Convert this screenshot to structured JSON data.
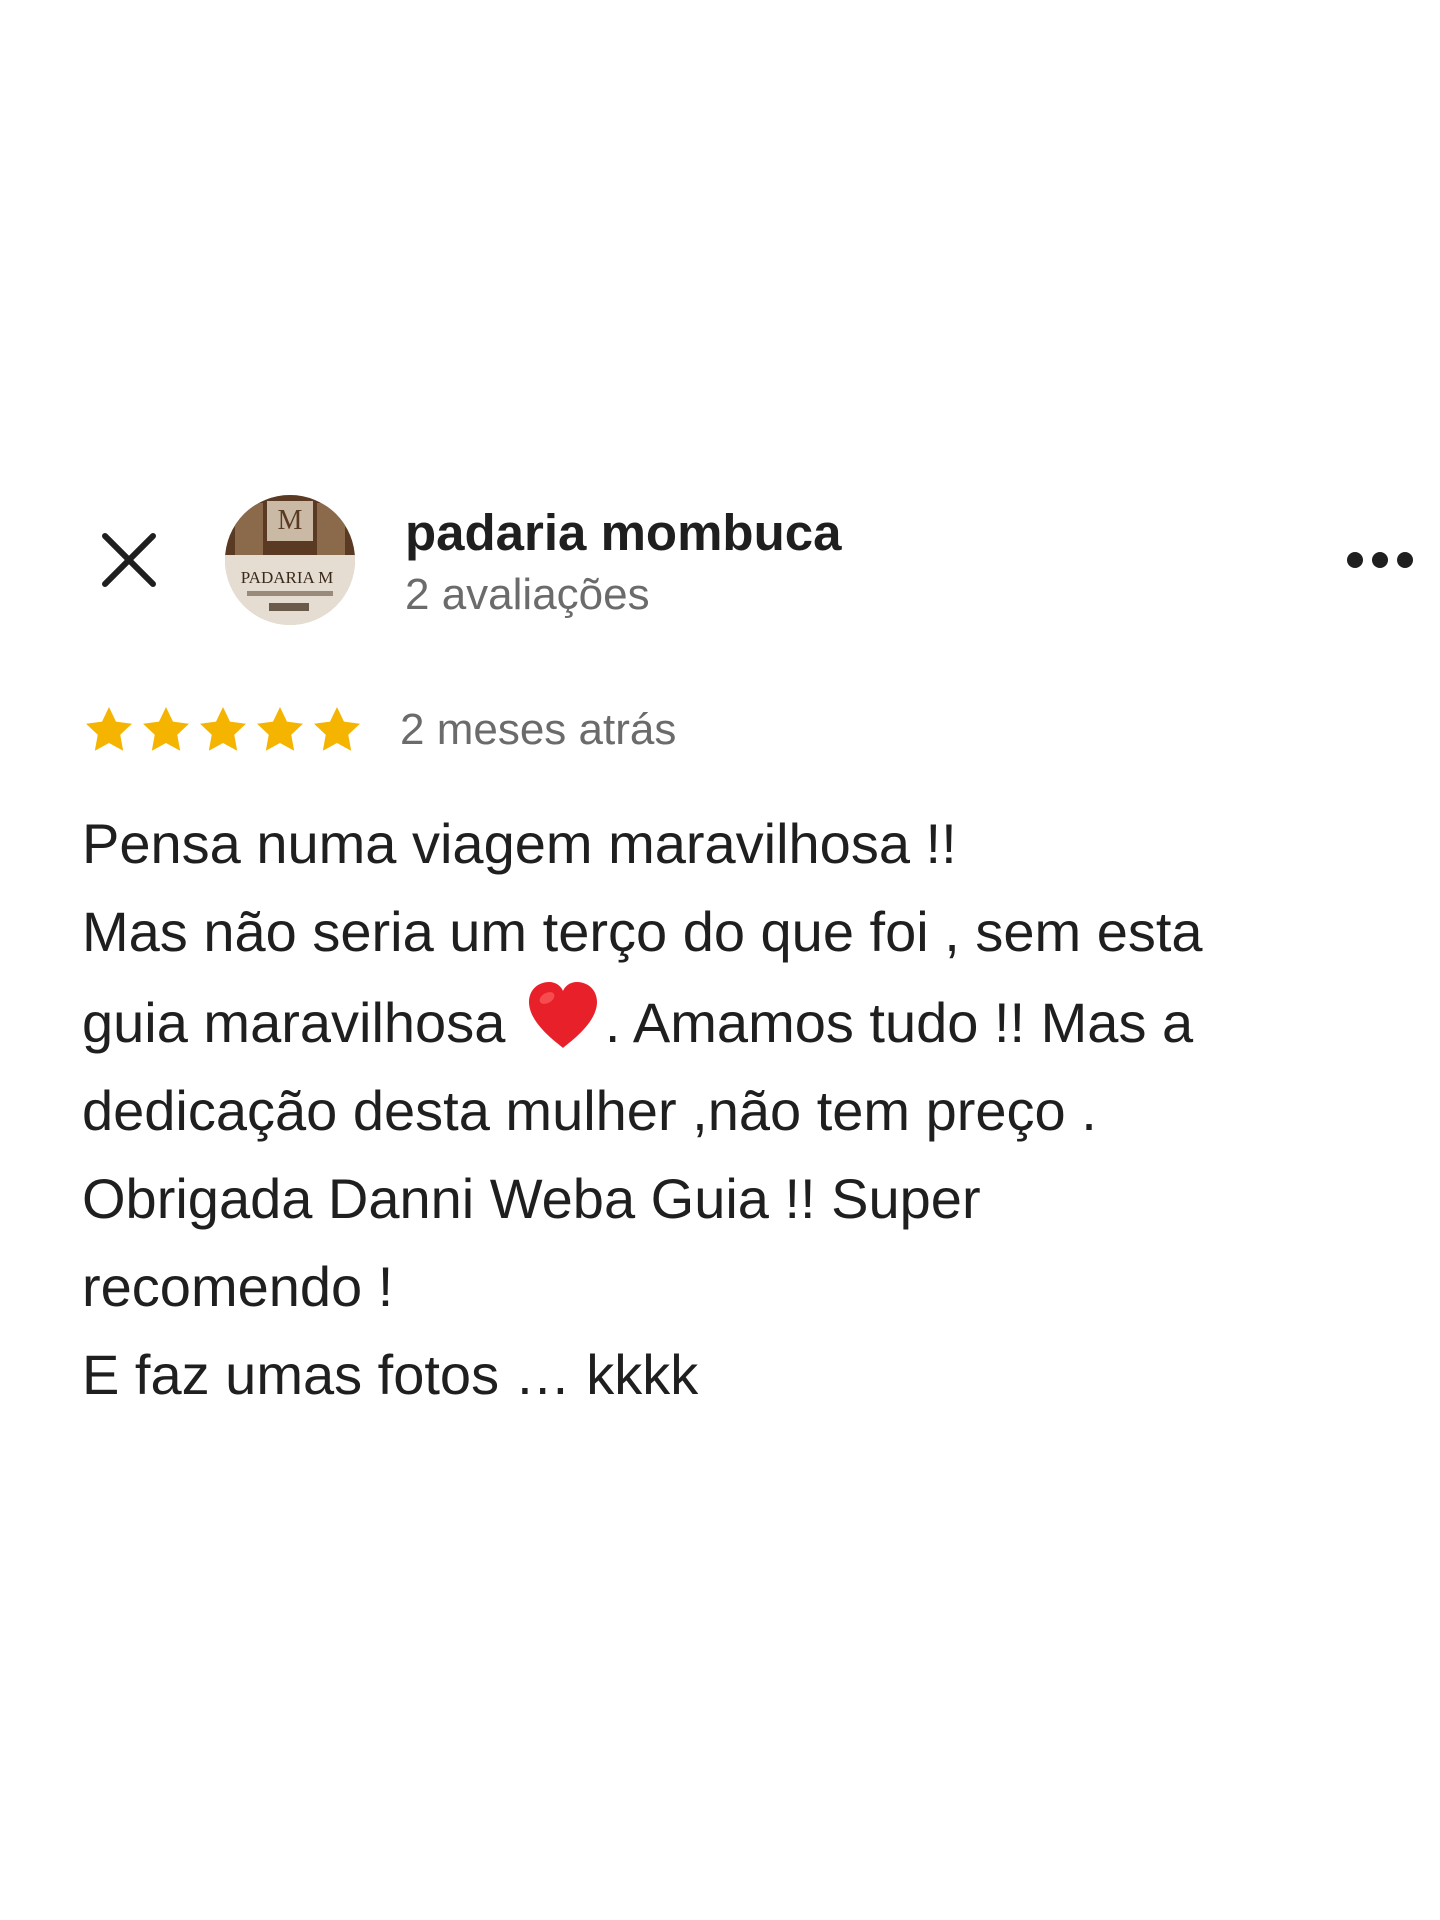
{
  "header": {
    "close_icon": "close-icon",
    "avatar_text": "PADARIA M",
    "author_name": "padaria mombuca",
    "author_meta": "2 avaliações",
    "more_icon": "more-horizontal-icon"
  },
  "rating": {
    "stars": 5,
    "max_stars": 5,
    "star_color": "#f5b400",
    "date": "2 meses atrás"
  },
  "review": {
    "line1": "Pensa numa viagem maravilhosa !!",
    "line2": "Mas não seria um terço do que foi , sem esta",
    "line3a": "guia maravilhosa ",
    "heart_icon": "red-heart-icon",
    "line3b": ". Amamos tudo !! Mas a",
    "line4": "dedicação desta mulher ,não tem preço .",
    "line5": "Obrigada Danni Weba Guia !! Super",
    "line6": "recomendo !",
    "line7": "E faz umas fotos … kkkk"
  }
}
